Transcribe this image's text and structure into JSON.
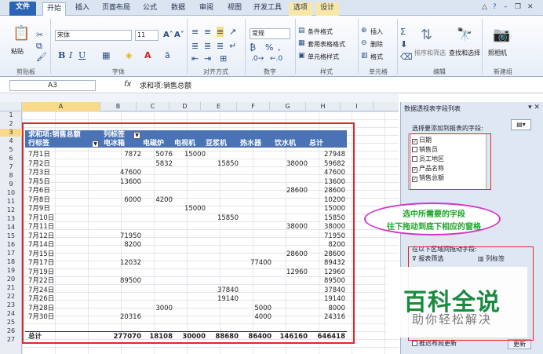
{
  "ribbon_tabs": [
    "文件",
    "开始",
    "插入",
    "页面布局",
    "公式",
    "数据",
    "审阅",
    "视图",
    "开发工具",
    "选项",
    "设计"
  ],
  "ribbon": {
    "font_name": "宋体",
    "font_size": "11",
    "number_format": "常规",
    "paste_label": "粘贴",
    "groups": [
      "剪贴板",
      "字体",
      "对齐方式",
      "数字",
      "样式",
      "单元格",
      "编辑",
      "新建组"
    ],
    "styles": [
      "条件格式",
      "套用表格格式",
      "单元格样式"
    ],
    "cells": [
      "插入",
      "删除",
      "格式"
    ],
    "editing": [
      "排序和筛选",
      "查找和选择"
    ],
    "camera_label": "照相机"
  },
  "formula_bar": {
    "name_box": "A3",
    "fx": "fx",
    "formula": "求和项:销售总额"
  },
  "sheet": {
    "columns": [
      "A",
      "B",
      "C",
      "D",
      "E",
      "F",
      "G",
      "H",
      "I"
    ],
    "selected_column": "A",
    "row_numbers": [
      "1",
      "2",
      "3",
      "4",
      "5",
      "6",
      "7",
      "8",
      "9",
      "10",
      "11",
      "12",
      "13",
      "14",
      "15",
      "16",
      "17",
      "18",
      "19",
      "20",
      "21",
      "22",
      "23",
      "24",
      "25",
      "26",
      "27"
    ],
    "selected_row": "3",
    "pivot": {
      "corner_label": "求和项:销售总额",
      "col_label": "列标签",
      "row_label": "行标签",
      "headers": [
        "电冰箱",
        "电磁炉",
        "电视机",
        "豆浆机",
        "热水器",
        "饮水机",
        "总计"
      ],
      "rows": [
        [
          "7月1日",
          "7872",
          "5076",
          "15000",
          "",
          "",
          "",
          "27948"
        ],
        [
          "7月2日",
          "",
          "5832",
          "",
          "15850",
          "",
          "38000",
          "59682"
        ],
        [
          "7月3日",
          "47600",
          "",
          "",
          "",
          "",
          "",
          "47600"
        ],
        [
          "7月5日",
          "13600",
          "",
          "",
          "",
          "",
          "",
          "13600"
        ],
        [
          "7月6日",
          "",
          "",
          "",
          "",
          "",
          "28600",
          "28600"
        ],
        [
          "7月8日",
          "6000",
          "4200",
          "",
          "",
          "",
          "",
          "10200"
        ],
        [
          "7月9日",
          "",
          "",
          "15000",
          "",
          "",
          "",
          "15000"
        ],
        [
          "7月10日",
          "",
          "",
          "",
          "15850",
          "",
          "",
          "15850"
        ],
        [
          "7月11日",
          "",
          "",
          "",
          "",
          "",
          "38000",
          "38000"
        ],
        [
          "7月12日",
          "71950",
          "",
          "",
          "",
          "",
          "",
          "71950"
        ],
        [
          "7月14日",
          "8200",
          "",
          "",
          "",
          "",
          "",
          "8200"
        ],
        [
          "7月15日",
          "",
          "",
          "",
          "",
          "",
          "28600",
          "28600"
        ],
        [
          "7月17日",
          "12032",
          "",
          "",
          "",
          "77400",
          "",
          "89432"
        ],
        [
          "7月19日",
          "",
          "",
          "",
          "",
          "",
          "12960",
          "12960"
        ],
        [
          "7月22日",
          "89500",
          "",
          "",
          "",
          "",
          "",
          "89500"
        ],
        [
          "7月24日",
          "",
          "",
          "",
          "37840",
          "",
          "",
          "37840"
        ],
        [
          "7月26日",
          "",
          "",
          "",
          "19140",
          "",
          "",
          "19140"
        ],
        [
          "7月28日",
          "",
          "3000",
          "",
          "",
          "5000",
          "",
          "8000"
        ],
        [
          "7月30日",
          "20316",
          "",
          "",
          "",
          "4000",
          "",
          "24316"
        ]
      ],
      "total_row": [
        "总计",
        "277070",
        "18108",
        "30000",
        "88680",
        "86400",
        "146160",
        "646418"
      ]
    }
  },
  "pane": {
    "title": "数据透视表字段列表",
    "choose_label": "选择要添加到报表的字段:",
    "fields": [
      {
        "label": "日期",
        "checked": true
      },
      {
        "label": "销售员",
        "checked": false
      },
      {
        "label": "员工地区",
        "checked": false
      },
      {
        "label": "产品名称",
        "checked": true
      },
      {
        "label": "销售总额",
        "checked": true
      }
    ],
    "drag_label": "在以下区域间拖动字段:",
    "report_filter": "报表筛选",
    "col_labels": "列标签",
    "defer_label": "推迟布局更新",
    "update_button": "更新"
  },
  "callout": {
    "line1": "选中所需要的字段",
    "line2": "往下拖动到底下相应的窗格"
  },
  "watermark": {
    "big": "百科全说",
    "small": "助你轻松解决"
  }
}
